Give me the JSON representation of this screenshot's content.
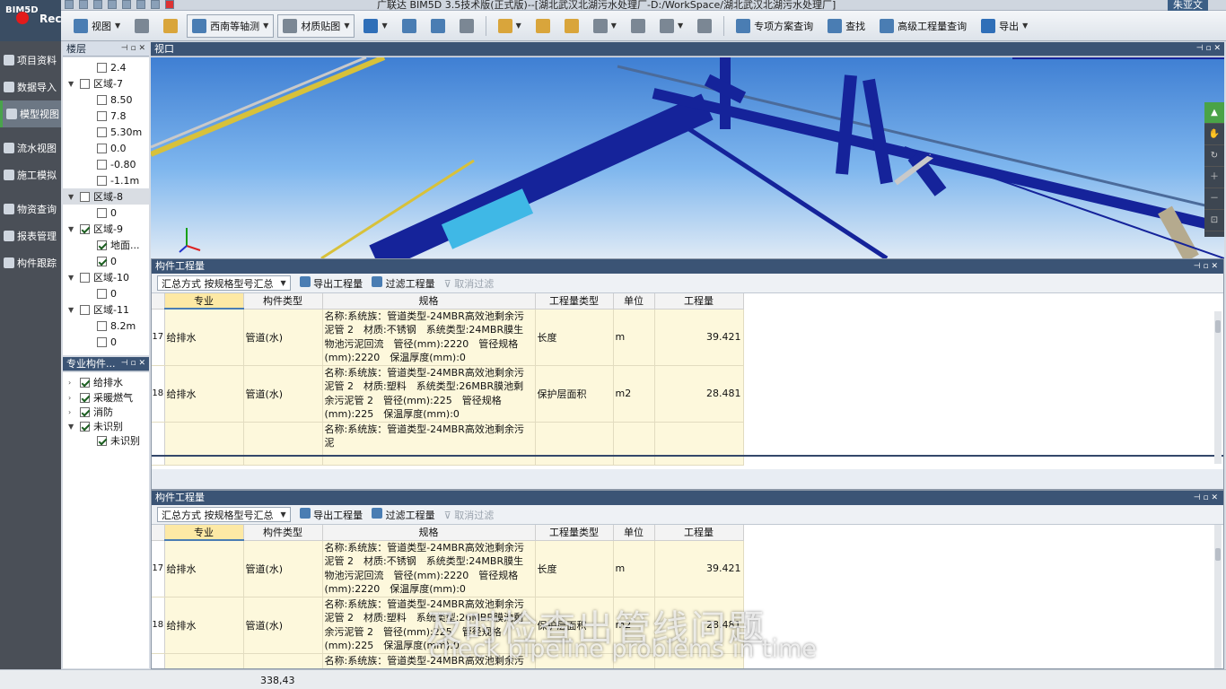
{
  "window": {
    "title": "广联达 BIM5D 3.5技术版(正式版)--[湖北武汉北湖污水处理厂-D:/WorkSpace/湖北武汉北湖污水处理厂]",
    "user": "朱亚文"
  },
  "app": {
    "logo": "BIM5D",
    "rec": "Rec"
  },
  "toolbar": {
    "view": "视图",
    "view_mode": "西南等轴测",
    "material": "材质贴图",
    "special_query": "专项方案查询",
    "find": "查找",
    "advanced_query": "高级工程量查询",
    "export": "导出"
  },
  "nav": [
    {
      "label": "项目资料",
      "active": false
    },
    {
      "label": "数据导入",
      "active": false
    },
    {
      "label": "模型视图",
      "active": true
    },
    {
      "label": "流水视图",
      "active": false
    },
    {
      "label": "施工模拟",
      "active": false
    },
    {
      "label": "物资查询",
      "active": false
    },
    {
      "label": "报表管理",
      "active": false
    },
    {
      "label": "构件跟踪",
      "active": false
    }
  ],
  "floors_panel": {
    "title": "楼层"
  },
  "floors": [
    {
      "label": "2.4",
      "level": 1,
      "checked": false
    },
    {
      "label": "区域-7",
      "level": 0,
      "checked": false
    },
    {
      "label": "8.50",
      "level": 1,
      "checked": false
    },
    {
      "label": "7.8",
      "level": 1,
      "checked": false
    },
    {
      "label": "5.30m",
      "level": 1,
      "checked": false
    },
    {
      "label": "0.0",
      "level": 1,
      "checked": false
    },
    {
      "label": "-0.80",
      "level": 1,
      "checked": false
    },
    {
      "label": "-1.1m",
      "level": 1,
      "checked": false
    },
    {
      "label": "区域-8",
      "level": 0,
      "checked": false,
      "selected": true
    },
    {
      "label": "0",
      "level": 1,
      "checked": false
    },
    {
      "label": "区域-9",
      "level": 0,
      "checked": true
    },
    {
      "label": "地面...",
      "level": 1,
      "checked": true
    },
    {
      "label": "0",
      "level": 1,
      "checked": true
    },
    {
      "label": "区域-10",
      "level": 0,
      "checked": false
    },
    {
      "label": "0",
      "level": 1,
      "checked": false
    },
    {
      "label": "区域-11",
      "level": 0,
      "checked": false
    },
    {
      "label": "8.2m",
      "level": 1,
      "checked": false
    },
    {
      "label": "0",
      "level": 1,
      "checked": false
    }
  ],
  "majors_panel": {
    "title": "专业构件..."
  },
  "majors": [
    {
      "label": "给排水",
      "level": 0,
      "checked": true
    },
    {
      "label": "采暖燃气",
      "level": 0,
      "checked": true
    },
    {
      "label": "消防",
      "level": 0,
      "checked": true
    },
    {
      "label": "未识别",
      "level": 0,
      "checked": true,
      "expanded": true
    },
    {
      "label": "未识别",
      "level": 1,
      "checked": true
    }
  ],
  "viewport": {
    "title": "视口"
  },
  "quantity_top": {
    "title": "构件工程量"
  },
  "quantity": {
    "title": "构件工程量",
    "summary_mode": "汇总方式 按规格型号汇总",
    "export_btn": "导出工程量",
    "filter_btn": "过滤工程量",
    "cancel_filter_btn": "取消过滤",
    "columns": [
      "专业",
      "构件类型",
      "规格",
      "工程量类型",
      "单位",
      "工程量"
    ],
    "rows": [
      {
        "no": "17",
        "major": "给排水",
        "type": "管道(水)",
        "spec": "名称:系统族：管道类型-24MBR高效池剩余污泥管 2　材质:不锈钢　系统类型:24MBR膜生物池污泥回流　管径(mm):2220　管径规格(mm):2220　保温厚度(mm):0",
        "qty_type": "长度",
        "unit": "m",
        "value": "39.421"
      },
      {
        "no": "18",
        "major": "给排水",
        "type": "管道(水)",
        "spec": "名称:系统族：管道类型-24MBR高效池剩余污泥管 2　材质:塑料　系统类型:26MBR膜池剩余污泥管 2　管径(mm):225　管径规格(mm):225　保温厚度(mm):0",
        "qty_type": "保护层面积",
        "unit": "m2",
        "value": "28.481"
      },
      {
        "no": "",
        "major": "",
        "type": "",
        "spec": "名称:系统族：管道类型-24MBR高效池剩余污泥",
        "qty_type": "",
        "unit": "",
        "value": ""
      }
    ]
  },
  "status": {
    "coords": "338,43"
  },
  "subtitle": {
    "cn": "及时检查出管线问题",
    "en": "check pipeline problems in time"
  }
}
